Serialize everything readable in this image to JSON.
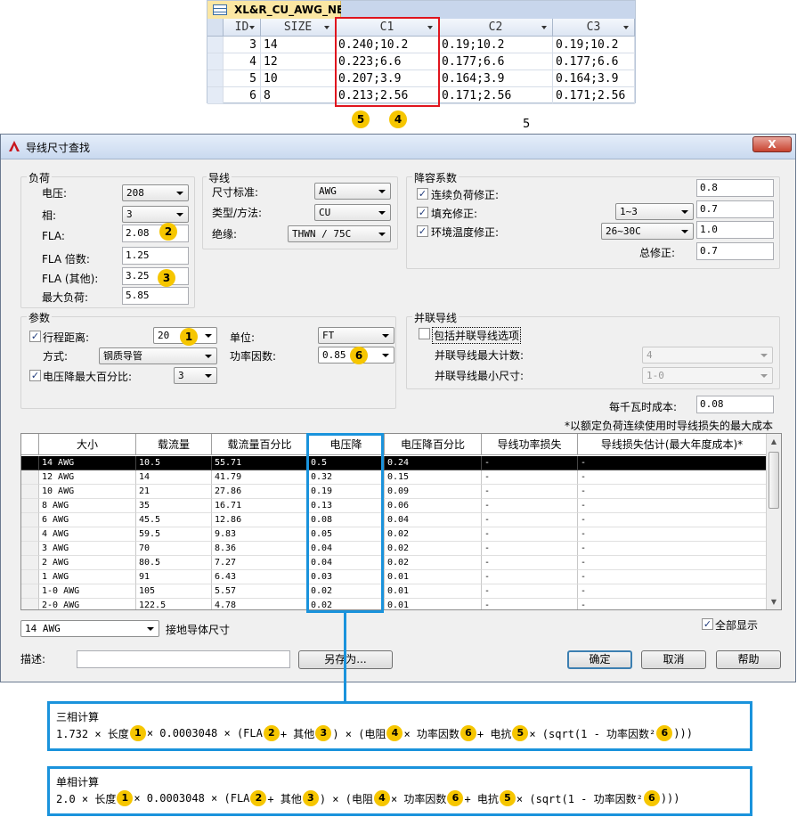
{
  "top_table": {
    "tab_title": "XL&R_CU_AWG_NEC",
    "columns": [
      "ID",
      "SIZE",
      "C1",
      "C2",
      "C3"
    ],
    "rows": [
      [
        "3",
        "14",
        "0.240;10.2",
        "0.19;10.2",
        "0.19;10.2"
      ],
      [
        "4",
        "12",
        "0.223;6.6",
        "0.177;6.6",
        "0.177;6.6"
      ],
      [
        "5",
        "10",
        "0.207;3.9",
        "0.164;3.9",
        "0.164;3.9"
      ],
      [
        "6",
        "8",
        "0.213;2.56",
        "0.171;2.56",
        "0.171;2.56"
      ]
    ]
  },
  "callouts": {
    "b5": "5",
    "b4": "4",
    "b2": "2",
    "b3": "3",
    "b1": "1",
    "b6": "6",
    "note5": "5"
  },
  "dialog": {
    "title": "导线尺寸查找",
    "close_label": "X",
    "load": {
      "title": "负荷",
      "voltage_label": "电压:",
      "voltage": "208",
      "phase_label": "相:",
      "phase": "3",
      "fla_label": "FLA:",
      "fla": "2.08",
      "fla_mult_label": "FLA 倍数:",
      "fla_mult": "1.25",
      "fla_other_label": "FLA (其他):",
      "fla_other": "3.25",
      "max_load_label": "最大负荷:",
      "max_load": "5.85"
    },
    "wire": {
      "title": "导线",
      "size_std_label": "尺寸标准:",
      "size_std": "AWG",
      "type_label": "类型/方法:",
      "type": "CU",
      "insul_label": "绝缘:",
      "insul": "THWN / 75C"
    },
    "derate": {
      "title": "降容系数",
      "cont_label": "连续负荷修正:",
      "cont": "0.8",
      "fill_label": "填充修正:",
      "fill_sel": "1~3",
      "fill": "0.7",
      "amb_label": "环境温度修正:",
      "amb_sel": "26~30C",
      "amb": "1.0",
      "total_label": "总修正:",
      "total": "0.7"
    },
    "params": {
      "title": "参数",
      "dist_label": "行程距离:",
      "dist": "20",
      "unit_label": "单位:",
      "unit": "FT",
      "method_label": "方式:",
      "method": "钢质导管",
      "pf_label": "功率因数:",
      "pf": "0.85",
      "vd_label": "电压降最大百分比:",
      "vd": "3"
    },
    "parallel": {
      "title": "并联导线",
      "include_label": "包括并联导线选项",
      "max_count_label": "并联导线最大计数:",
      "max_count": "4",
      "min_size_label": "并联导线最小尺寸:",
      "min_size": "1-0"
    },
    "cost_label": "每千瓦时成本:",
    "cost": "0.08",
    "note": "*以额定负荷连续使用时导线损失的最大成本",
    "grid": {
      "columns": [
        "大小",
        "载流量",
        "载流量百分比",
        "电压降",
        "电压降百分比",
        "导线功率损失",
        "导线损失估计(最大年度成本)*"
      ],
      "rows": [
        [
          "14 AWG",
          "10.5",
          "55.71",
          "0.5",
          "0.24",
          "-",
          "-"
        ],
        [
          "12 AWG",
          "14",
          "41.79",
          "0.32",
          "0.15",
          "-",
          "-"
        ],
        [
          "10 AWG",
          "21",
          "27.86",
          "0.19",
          "0.09",
          "-",
          "-"
        ],
        [
          "8 AWG",
          "35",
          "16.71",
          "0.13",
          "0.06",
          "-",
          "-"
        ],
        [
          "6 AWG",
          "45.5",
          "12.86",
          "0.08",
          "0.04",
          "-",
          "-"
        ],
        [
          "4 AWG",
          "59.5",
          "9.83",
          "0.05",
          "0.02",
          "-",
          "-"
        ],
        [
          "3 AWG",
          "70",
          "8.36",
          "0.04",
          "0.02",
          "-",
          "-"
        ],
        [
          "2 AWG",
          "80.5",
          "7.27",
          "0.04",
          "0.02",
          "-",
          "-"
        ],
        [
          "1 AWG",
          "91",
          "6.43",
          "0.03",
          "0.01",
          "-",
          "-"
        ],
        [
          "1-0 AWG",
          "105",
          "5.57",
          "0.02",
          "0.01",
          "-",
          "-"
        ],
        [
          "2-0 AWG",
          "122.5",
          "4.78",
          "0.02",
          "0.01",
          "-",
          "-"
        ]
      ]
    },
    "ground_sel": "14 AWG",
    "ground_label": "接地导体尺寸",
    "show_all_label": "全部显示",
    "desc_label": "描述:",
    "save_as": "另存为...",
    "ok": "确定",
    "cancel": "取消",
    "help": "帮助"
  },
  "formula3": {
    "title": "三相计算",
    "p1": "1.732 × 长度",
    "p2": "× 0.0003048 × (FLA",
    "p3": "+ 其他",
    "p4": ") × (电阻",
    "p5": "× 功率因数",
    "p6": "+ 电抗",
    "p7": "× (sqrt(1 - 功率因数²",
    "p8": ")))"
  },
  "formula1": {
    "title": "单相计算",
    "p1": "2.0 × 长度",
    "p2": "× 0.0003048 × (FLA",
    "p3": "+ 其他",
    "p4": ") × (电阻",
    "p5": "× 功率因数",
    "p6": "+ 电抗",
    "p7": "× (sqrt(1 - 功率因数²",
    "p8": ")))"
  }
}
